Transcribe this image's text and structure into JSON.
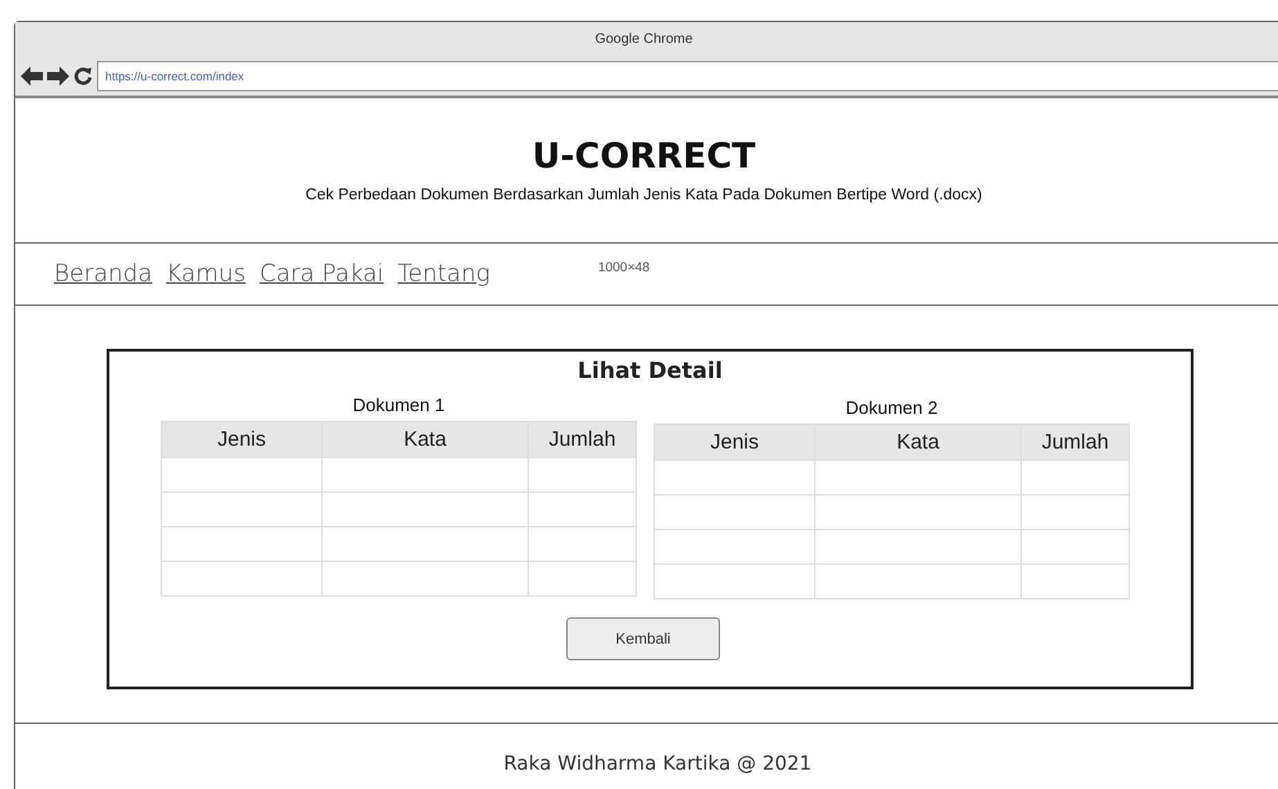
{
  "window": {
    "title": "Google Chrome"
  },
  "browser": {
    "url": "https://u-correct.com/index"
  },
  "header": {
    "title": "U-CORRECT",
    "subtitle": "Cek Perbedaan Dokumen Berdasarkan Jumlah Jenis Kata Pada Dokumen Bertipe Word (.docx)"
  },
  "nav": {
    "links": [
      "Beranda",
      "Kamus",
      "Cara Pakai",
      "Tentang"
    ],
    "note": "1000×48"
  },
  "panel": {
    "title": "Lihat Detail",
    "tables": [
      {
        "title": "Dokumen 1",
        "columns": [
          "Jenis",
          "Kata",
          "Jumlah"
        ],
        "rows": [
          {
            "kind": "empty"
          },
          {
            "kind": "empty"
          },
          {
            "kind": "empty"
          },
          {
            "kind": "empty"
          }
        ]
      },
      {
        "title": "Dokumen 2",
        "columns": [
          "Jenis",
          "Kata",
          "Jumlah"
        ],
        "rows": [
          {
            "kind": "empty"
          },
          {
            "kind": "empty"
          },
          {
            "kind": "empty"
          },
          {
            "kind": "empty"
          }
        ]
      }
    ],
    "button": "Kembali"
  },
  "footer": {
    "text": "Raka Widharma Kartika @ 2021"
  }
}
